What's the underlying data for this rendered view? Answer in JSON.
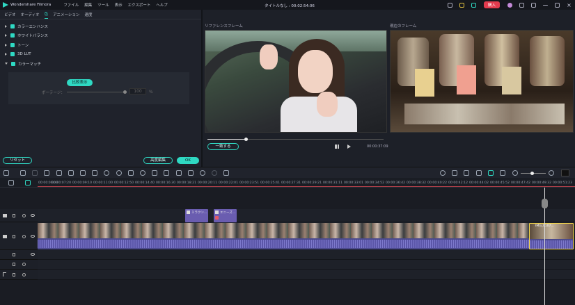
{
  "app": {
    "name": "Wondershare Filmora",
    "title": "タイトルなし : 00:02:54:06",
    "buy_label": "購入"
  },
  "menu": [
    "ファイル",
    "編集",
    "ツール",
    "表示",
    "エクスポート",
    "ヘルプ"
  ],
  "left_tabs": [
    "ビデオ",
    "オーディオ",
    "色",
    "アニメーション",
    "速度"
  ],
  "properties": [
    "カラーエンハンス",
    "ホワイトバランス",
    "トーン",
    "3D LUT",
    "カラーマッチ"
  ],
  "colormatch": {
    "compare_label": "比較表示",
    "slider_label": "ポーテージ：",
    "value": "100",
    "unit": "%"
  },
  "left_buttons": {
    "reset": "リセット",
    "advanced": "高度編集",
    "ok": "OK"
  },
  "preview": {
    "reference_label": "リファレンスフレーム",
    "current_label": "現在のフレーム",
    "match_button": "一致する",
    "timecode": "00:00:37:09"
  },
  "timeline": {
    "timecodes": [
      "00:00:00:00",
      "00:00:07:20",
      "00:00:09:10",
      "00:00:11:00",
      "00:00:12:50",
      "00:00:14:40",
      "00:00:16:30",
      "00:00:18:21",
      "00:00:20:11",
      "00:00:22:01",
      "00:00:23:51",
      "00:00:25:41",
      "00:00:27:31",
      "00:00:29:21",
      "00:00:31:11",
      "00:00:33:01",
      "00:00:34:52",
      "00:00:36:42",
      "00:00:38:32",
      "00:00:40:22",
      "00:00:42:12",
      "00:00:44:02",
      "00:00:45:52",
      "00:00:47:42",
      "00:00:49:32",
      "00:00:51:23"
    ],
    "title_clips": [
      "ミラクン...",
      "エニーズ..."
    ],
    "selected_clip": "IMG_0107..."
  },
  "colors": {
    "accent": "#2fd9c3",
    "buy": "#e23b4e",
    "clip": "#5b56a8"
  }
}
